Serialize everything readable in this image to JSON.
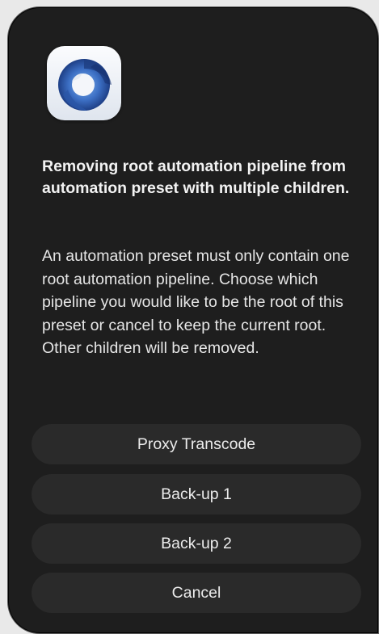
{
  "dialog": {
    "icon": "aperture-app-icon",
    "title": "Removing root automation pipeline from automation preset with multiple children.",
    "message": "An automation preset must only contain one root automation pipeline. Choose which pipeline you would like to be the root of this preset or cancel to keep the current root. Other children will be removed.",
    "buttons": {
      "proxy_transcode": "Proxy Transcode",
      "backup_1": "Back-up 1",
      "backup_2": "Back-up 2",
      "cancel": "Cancel"
    }
  },
  "colors": {
    "dialog_background": "#1e1e1e",
    "button_background": "#2a2a2a",
    "text": "#f2f2f2",
    "icon_blue": "#3f6fbf"
  }
}
